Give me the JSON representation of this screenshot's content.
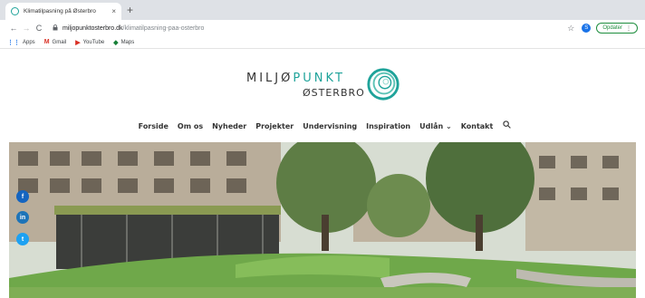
{
  "browser": {
    "tab_title": "Klimatilpasning på Østerbro",
    "tab_close": "×",
    "new_tab": "+",
    "back": "←",
    "forward": "→",
    "reload": "C",
    "url_host": "miljopunktosterbro.dk",
    "url_path": "/klimatilpasning-paa-osterbro",
    "profile_initial": "S",
    "update_label": "Opdater",
    "bookmarks": [
      {
        "label": "Apps",
        "icon": "apps-grid-icon"
      },
      {
        "label": "Gmail",
        "icon": "gmail-icon"
      },
      {
        "label": "YouTube",
        "icon": "youtube-icon"
      },
      {
        "label": "Maps",
        "icon": "maps-icon"
      }
    ]
  },
  "site": {
    "logo_line1_a": "MILJØ",
    "logo_line1_b": "PUNKT",
    "logo_line2": "ØSTERBRO",
    "nav": [
      "Forside",
      "Om os",
      "Nyheder",
      "Projekter",
      "Undervisning",
      "Inspiration",
      "Udlån ⌄",
      "Kontakt"
    ],
    "social": {
      "facebook": "f",
      "linkedin": "in",
      "twitter": "t"
    }
  },
  "colors": {
    "accent": "#1fa39a",
    "facebook": "#1565c0",
    "linkedin": "#1e74b8",
    "twitter": "#1da1f2"
  }
}
